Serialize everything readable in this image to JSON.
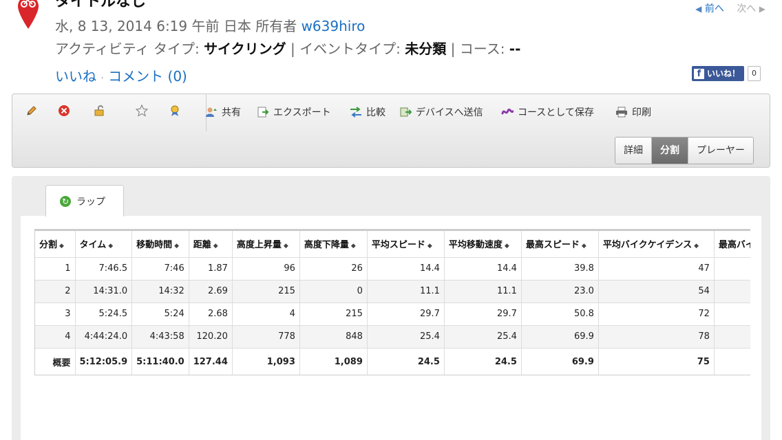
{
  "header": {
    "title": "タイトルなし",
    "date": "水, 8 13, 2014 6:19 午前 日本 所有者",
    "owner": "w639hiro",
    "activity_label": "アクティビティ タイプ:",
    "activity_value": "サイクリング",
    "event_label": "| イベントタイプ:",
    "event_value": "未分類",
    "course_label": "| コース:",
    "course_value": "--",
    "like_link": "いいね",
    "dot": "·",
    "comment_link": "コメント (0)"
  },
  "pager": {
    "prev": "前へ",
    "next": "次へ"
  },
  "facebook": {
    "label": "いいね！",
    "count": "0"
  },
  "toolbar": {
    "share": "共有",
    "export": "エクスポート",
    "compare": "比較",
    "send": "デバイスへ送信",
    "save_course": "コースとして保存",
    "print": "印刷"
  },
  "view_modes": {
    "details": "詳細",
    "splits": "分割",
    "player": "プレーヤー"
  },
  "tab": {
    "laps": "ラップ"
  },
  "table": {
    "headers": [
      "分割",
      "タイム",
      "移動時間",
      "距離",
      "高度上昇量",
      "高度下降量",
      "平均スピード",
      "平均移動速度",
      "最高スピード",
      "平均バイクケイデンス",
      "最高バイクケ"
    ],
    "rows": [
      [
        "1",
        "7:46.5",
        "7:46",
        "1.87",
        "96",
        "26",
        "14.4",
        "14.4",
        "39.8",
        "47",
        ""
      ],
      [
        "2",
        "14:31.0",
        "14:32",
        "2.69",
        "215",
        "0",
        "11.1",
        "11.1",
        "23.0",
        "54",
        ""
      ],
      [
        "3",
        "5:24.5",
        "5:24",
        "2.68",
        "4",
        "215",
        "29.7",
        "29.7",
        "50.8",
        "72",
        ""
      ],
      [
        "4",
        "4:44:24.0",
        "4:43:58",
        "120.20",
        "778",
        "848",
        "25.4",
        "25.4",
        "69.9",
        "78",
        ""
      ]
    ],
    "summary": [
      "概要",
      "5:12:05.9",
      "5:11:40.0",
      "127.44",
      "1,093",
      "1,089",
      "24.5",
      "24.5",
      "69.9",
      "75",
      ""
    ]
  },
  "colors": {
    "link": "#1a6fc2",
    "facebook": "#3b5998",
    "pin": "#d9262b"
  }
}
